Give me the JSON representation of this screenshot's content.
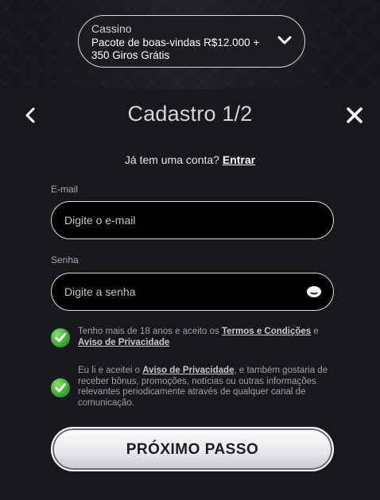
{
  "bonus": {
    "category": "Cassino",
    "title_line1": "Pacote de boas-vindas R$12.000 +",
    "title_line2": "350 Giros Grátis"
  },
  "header": {
    "title": "Cadastro 1/2"
  },
  "login": {
    "prompt": "Já tem uma conta?",
    "link": "Entrar"
  },
  "email": {
    "label": "E-mail",
    "placeholder": "Digite o e-mail",
    "value": ""
  },
  "password": {
    "label": "Senha",
    "placeholder": "Digite a senha",
    "value": ""
  },
  "consent_age": {
    "checked": true,
    "text_1": "Tenho mais de 18 anos e aceito os",
    "link_terms": "Termos e Condições",
    "text_2": "e",
    "link_privacy": "Aviso de Privacidade"
  },
  "consent_marketing": {
    "checked": true,
    "text_1": "Eu li e aceitei o",
    "link_privacy": "Aviso de Privacidade",
    "text_2": ", e também gostaria de receber bônus, promoções, notícias ou outras informações relevantes periodicamente através de qualquer canal de comunicação."
  },
  "next_button": {
    "label": "PRÓXIMO PASSO"
  },
  "colors": {
    "background": "#141619",
    "check_green": "#3fb233",
    "title_gray": "#d4d4da"
  },
  "icons": {
    "bonus_dropdown": "chevron-down-icon",
    "back": "chevron-left-icon",
    "close": "close-icon",
    "password_toggle": "eye-icon",
    "consent": "check-circle-icon"
  }
}
